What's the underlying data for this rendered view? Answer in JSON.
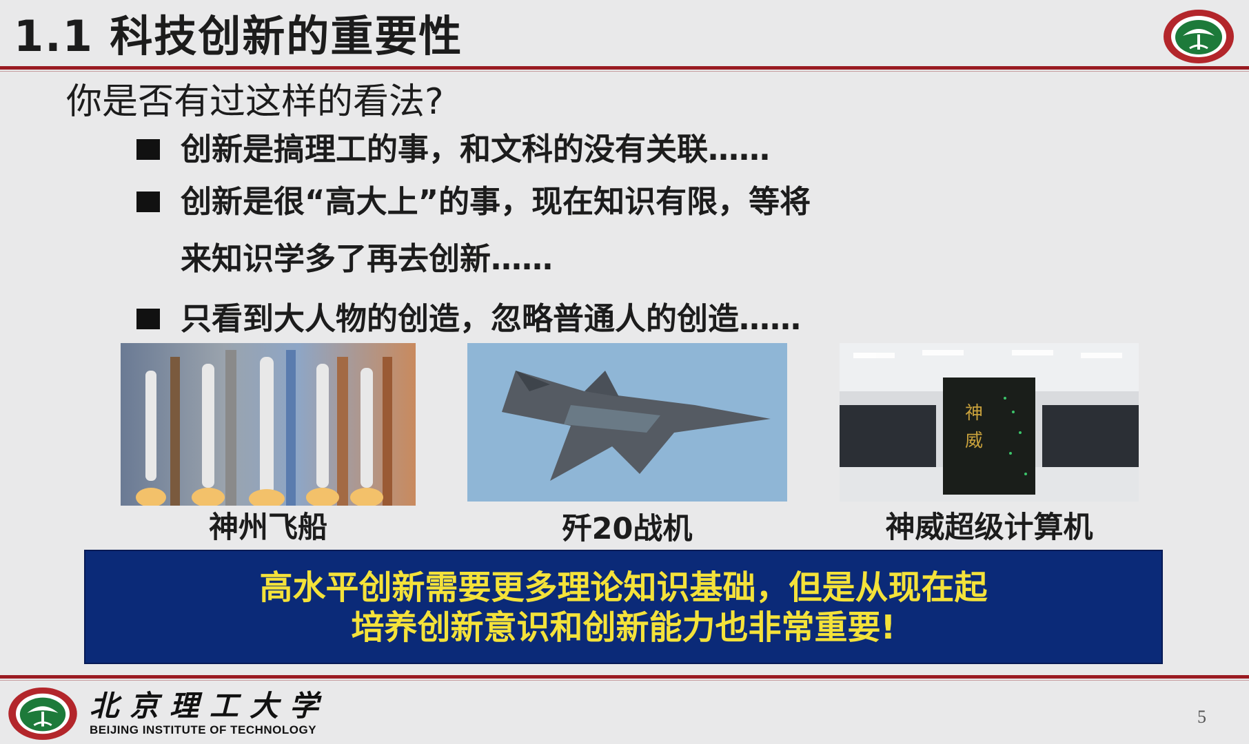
{
  "header": {
    "title": "1.1 科技创新的重要性"
  },
  "question": "你是否有过这样的看法?",
  "bullets": [
    "创新是搞理工的事，和文科的没有关联……",
    "创新是很“高大上”的事，现在知识有限，等将",
    "来知识学多了再去创新……",
    "只看到大人物的创造，忽略普通人的创造……"
  ],
  "photos": [
    {
      "caption": "神州飞船"
    },
    {
      "caption": "歼20战机"
    },
    {
      "caption": "神威超级计算机",
      "tower_text_1": "神",
      "tower_text_2": "威"
    }
  ],
  "highlight": {
    "line1": "高水平创新需要更多理论知识基础，但是从现在起",
    "line2": "培养创新意识和创新能力也非常重要!"
  },
  "footer": {
    "school_cn": "北京理工大学",
    "school_en": "BEIJING INSTITUTE OF TECHNOLOGY",
    "page_number": "5"
  },
  "colors": {
    "accent_red": "#9a1b22",
    "box_blue": "#0b2a78",
    "box_text_yellow": "#f4e23a",
    "logo_green": "#1d7a3a"
  }
}
